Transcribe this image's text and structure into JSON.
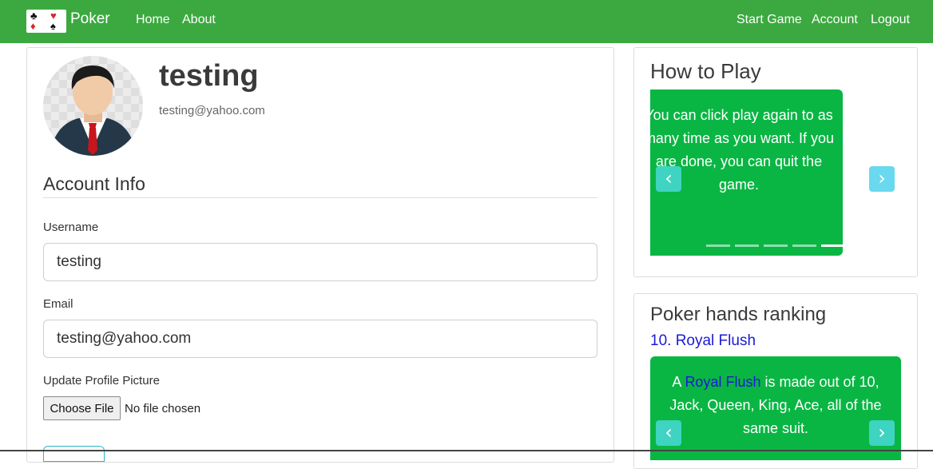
{
  "nav": {
    "brand": "Poker",
    "left_links": [
      "Home",
      "About"
    ],
    "right_links": [
      "Start Game",
      "Account",
      "Logout"
    ]
  },
  "profile": {
    "name": "testing",
    "email": "testing@yahoo.com"
  },
  "account_info": {
    "title": "Account Info",
    "username_label": "Username",
    "username_value": "testing",
    "email_label": "Email",
    "email_value": "testing@yahoo.com",
    "picture_label": "Update Profile Picture",
    "choose_file_label": "Choose File",
    "file_status": "No file chosen"
  },
  "how_to_play": {
    "title": "How to Play",
    "slide_text": "You can click play again to as many time as you want. If you are done, you can quit the game.",
    "slide_count": 5,
    "active_slide": 5
  },
  "hands_ranking": {
    "title": "Poker hands ranking",
    "hand_title": "10. Royal Flush",
    "desc_prefix": "A ",
    "desc_link": "Royal Flush",
    "desc_suffix": " is made out of 10, Jack, Queen, King, Ace, all of the same suit."
  },
  "colors": {
    "navbar": "#3ba93f",
    "carousel": "#09b643",
    "link": "#1a1ad6",
    "control": "#3fd3c1"
  },
  "icons": {
    "prev": "chevron-left-icon",
    "next": "chevron-right-icon",
    "logo": "card-suits-logo-icon"
  }
}
